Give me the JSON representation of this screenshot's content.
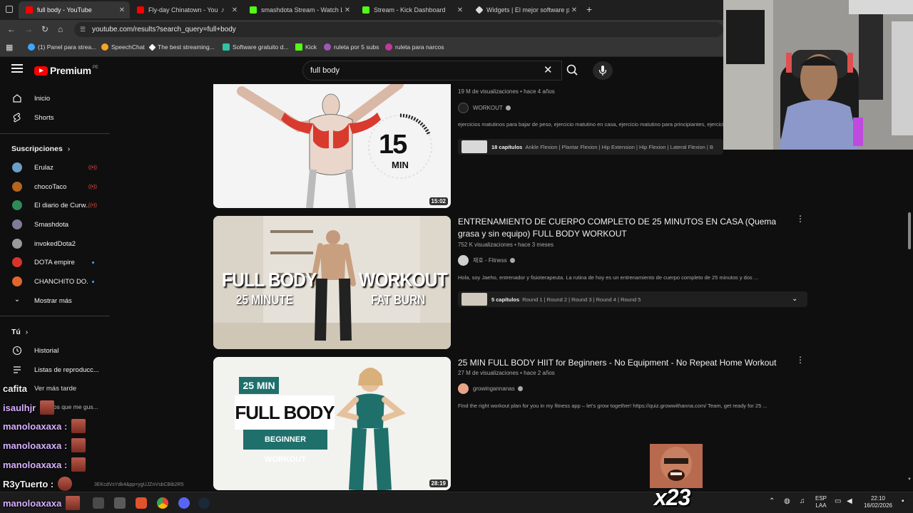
{
  "tabs": [
    {
      "title": "full body - YouTube",
      "active": true,
      "color": "#ff0000"
    },
    {
      "title": "Fly-day Chinatown - YouTube",
      "active": false,
      "color": "#ff0000"
    },
    {
      "title": "smashdota Stream - Watch Live",
      "active": false,
      "color": "#53fc18"
    },
    {
      "title": "Stream - Kick Dashboard",
      "active": false,
      "color": "#53fc18"
    },
    {
      "title": "Widgets | El mejor software para",
      "active": false,
      "color": "#dddddd"
    }
  ],
  "address": {
    "url": "youtube.com/results?search_query=full+body"
  },
  "bookmarks": [
    {
      "label": "(1) Panel para strea...",
      "color": "#3ea6ff"
    },
    {
      "label": "SpeechChat",
      "color": "#f5a623"
    },
    {
      "label": "The best streaming...",
      "color": "#ffffff"
    },
    {
      "label": "Software gratuito d...",
      "color": "#31c3a2"
    },
    {
      "label": "Kick",
      "color": "#53fc18"
    },
    {
      "label": "ruleta por 5 subs",
      "color": "#9b59b6"
    },
    {
      "label": "ruleta para narcos",
      "color": "#c0399b"
    }
  ],
  "youtube": {
    "logo_text": "Premium",
    "country": "PE",
    "search_query": "full body"
  },
  "sidebar": {
    "home": "Inicio",
    "shorts": "Shorts",
    "subs_header": "Suscripciones",
    "channels": [
      {
        "name": "Erulaz",
        "status": "live",
        "color": "#6aa0c8"
      },
      {
        "name": "chocoTaco",
        "status": "live",
        "color": "#b5651d"
      },
      {
        "name": "El diario de Curw...",
        "status": "live",
        "color": "#2e8b57"
      },
      {
        "name": "Smashdota",
        "status": "",
        "color": "#7d7d9a"
      },
      {
        "name": "invokedDota2",
        "status": "",
        "color": "#9a9a9a"
      },
      {
        "name": "DOTA empire",
        "status": "new",
        "color": "#d9342b"
      },
      {
        "name": "CHANCHITO DO...",
        "status": "new",
        "color": "#e0662b"
      }
    ],
    "show_more": "Mostrar más",
    "you_header": "Tú",
    "history": "Historial",
    "playlists": "Listas de reproducc...",
    "watch_later": "Ver más tarde",
    "liked": "Videos que me gus..."
  },
  "results": [
    {
      "title": "",
      "meta": "19 M de visualizaciones • hace 4 años",
      "channel": "WORKOUT",
      "description": "ejercicios matutinos para bajar de peso, ejercicio matutino en casa, ejercicio matutino para principiantes, ejercicios",
      "chapters_count": "18 capítulos",
      "chapters": "Ankle Flexion | Plantar Flexion | Hip Extension | Hip Flexion | Lateral Flexion | B",
      "duration": "15:02",
      "thumb_big": "15",
      "thumb_unit": "MIN"
    },
    {
      "title": "ENTRENAMIENTO DE CUERPO COMPLETO DE 25 MINUTOS EN CASA (Quema grasa y sin equipo) FULL BODY WORKOUT",
      "meta": "752 K visualizaciones • hace 3 meses",
      "channel": "재호 - Fitness",
      "description": "Hola, soy Jaeho, entrenador y fisioterapeuta. La rutina de hoy es un entrenamiento de cuerpo completo de 25 minutos y dos ...",
      "chapters_count": "5 capítulos",
      "chapters": "Round 1 | Round 2 | Round 3 | Round 4 | Round 5",
      "thumb_left_1": "FULL BODY",
      "thumb_left_2": "25 MINUTE",
      "thumb_right_1": "WORKOUT",
      "thumb_right_2": "FAT BURN"
    },
    {
      "title": "25 MIN FULL BODY HIIT for Beginners - No Equipment - No Repeat Home Workout",
      "meta": "27 M de visualizaciones • hace 2 años",
      "channel": "growingannanas",
      "description": "Find the right workout plan for you in my fitness app – let's grow together! https://quiz.growwithanna.com/ Team, get ready for 25 ...",
      "duration": "28:19",
      "thumb_tag": "25 MIN",
      "thumb_main": "FULL BODY",
      "thumb_sub": "BEGINNER WORKOUT"
    }
  ],
  "chat": [
    {
      "user": "cafita",
      "msg": ""
    },
    {
      "user": "isaulhjr",
      "msg": ""
    },
    {
      "user": "manoloaxaxa :",
      "msg": ""
    },
    {
      "user": "manoloaxaxa :",
      "msg": ""
    },
    {
      "user": "manoloaxaxa :",
      "msg": ""
    },
    {
      "user": "R3yTuerto :",
      "msg": ""
    },
    {
      "user": "manoloaxaxa",
      "msg": ""
    }
  ],
  "chat_overlap_text": "3EKcdVsYdk4&pp=ygUJZnVsbCBib2R5",
  "emote_counter": "x23",
  "taskbar": {
    "lang_1": "ESP",
    "lang_2": "LAA",
    "time": "22:10",
    "date": "16/02/2026"
  }
}
